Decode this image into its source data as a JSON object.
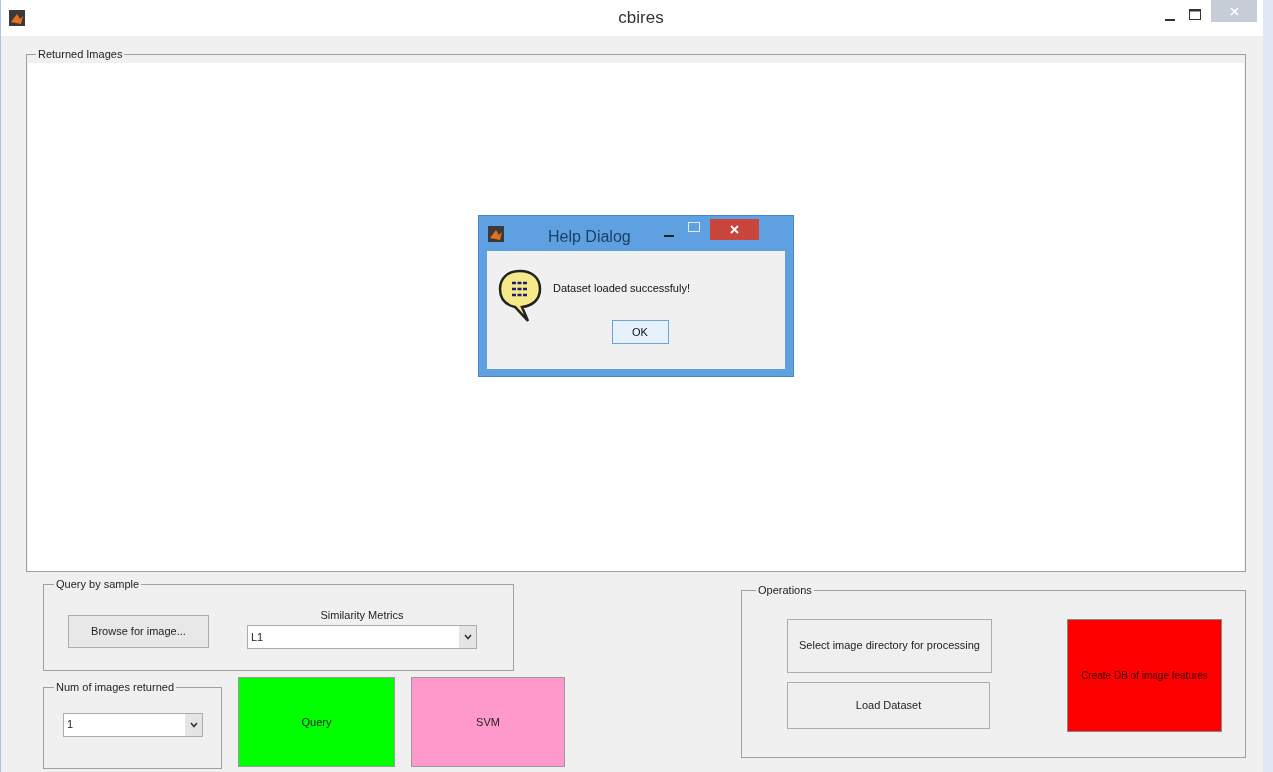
{
  "window": {
    "title": "cbires"
  },
  "returned_images": {
    "title": "Returned Images"
  },
  "query_by_sample": {
    "title": "Query by sample",
    "browse_button": "Browse for image...",
    "metric_label": "Similarity Metrics",
    "metric_value": "L1"
  },
  "num_images": {
    "title": "Num of images returned",
    "value": "1"
  },
  "action_buttons": [
    {
      "label": "Query",
      "color": "#00ff00"
    },
    {
      "label": "SVM",
      "color": "#ff99cc"
    }
  ],
  "operations": {
    "title": "Operations",
    "buttons": [
      {
        "label": "Select image directory for processing",
        "color": "#efefef"
      },
      {
        "label": "Load Dataset",
        "color": "#efefef"
      },
      {
        "label": "Create DB of image features",
        "color": "#ff0000"
      }
    ]
  },
  "dialog": {
    "title": "Help Dialog",
    "message": "Dataset loaded successfuly!",
    "ok_button": "OK"
  }
}
